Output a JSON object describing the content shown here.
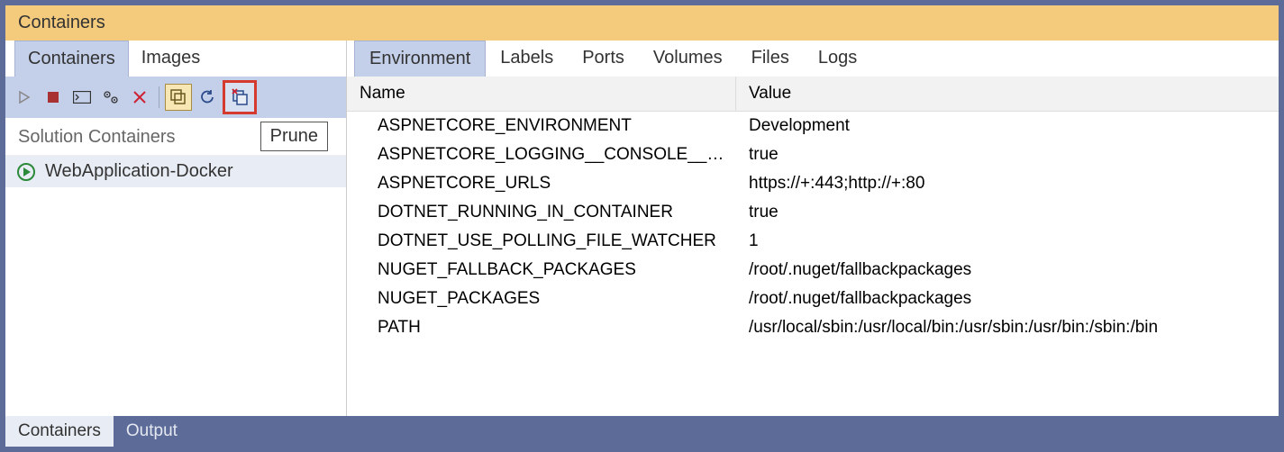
{
  "title": "Containers",
  "left": {
    "tabs": [
      "Containers",
      "Images"
    ],
    "active_tab": 0,
    "section_header": "Solution Containers",
    "tooltip": "Prune",
    "items": [
      {
        "label": "WebApplication-Docker",
        "running": true
      }
    ]
  },
  "right": {
    "tabs": [
      "Environment",
      "Labels",
      "Ports",
      "Volumes",
      "Files",
      "Logs"
    ],
    "active_tab": 0,
    "columns": {
      "name": "Name",
      "value": "Value"
    },
    "rows": [
      {
        "name": "ASPNETCORE_ENVIRONMENT",
        "value": "Development"
      },
      {
        "name": "ASPNETCORE_LOGGING__CONSOLE__DISA…",
        "value": "true"
      },
      {
        "name": "ASPNETCORE_URLS",
        "value": "https://+:443;http://+:80"
      },
      {
        "name": "DOTNET_RUNNING_IN_CONTAINER",
        "value": "true"
      },
      {
        "name": "DOTNET_USE_POLLING_FILE_WATCHER",
        "value": "1"
      },
      {
        "name": "NUGET_FALLBACK_PACKAGES",
        "value": "/root/.nuget/fallbackpackages"
      },
      {
        "name": "NUGET_PACKAGES",
        "value": "/root/.nuget/fallbackpackages"
      },
      {
        "name": "PATH",
        "value": "/usr/local/sbin:/usr/local/bin:/usr/sbin:/usr/bin:/sbin:/bin"
      }
    ]
  },
  "bottom_tabs": {
    "items": [
      "Containers",
      "Output"
    ],
    "active": 0
  }
}
